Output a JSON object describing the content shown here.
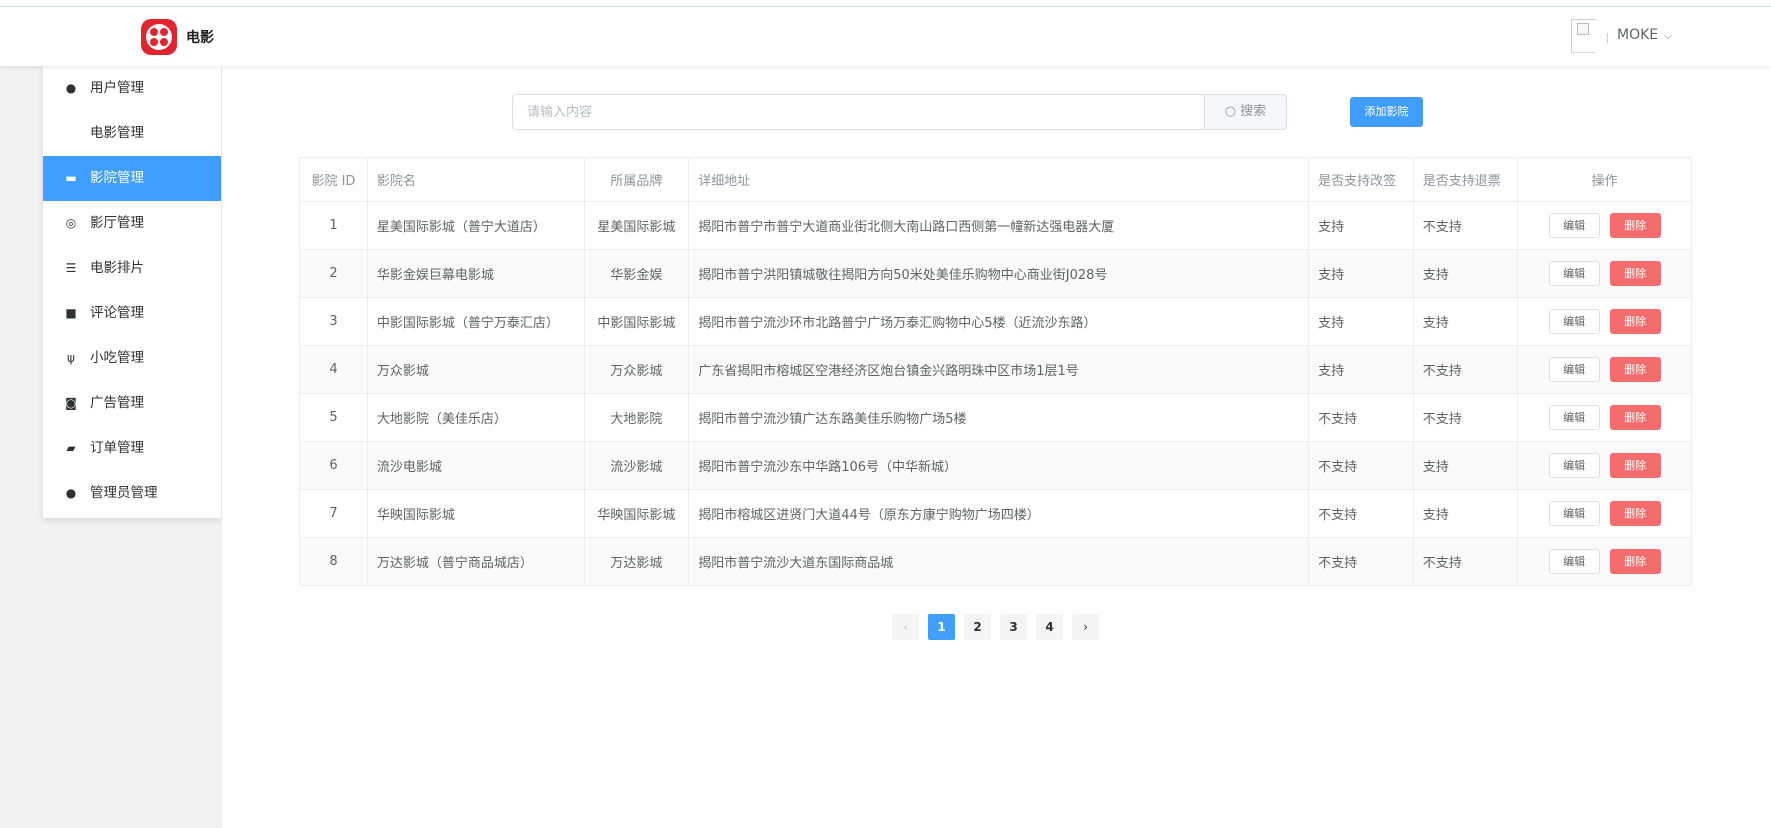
{
  "app": {
    "brand": "电影"
  },
  "user": {
    "name": "MOKE",
    "chevron": "⌵"
  },
  "sidebar": {
    "items": [
      {
        "label": "用户管理",
        "icon": "●"
      },
      {
        "label": "电影管理",
        "icon": ""
      },
      {
        "label": "影院管理",
        "icon": "▬"
      },
      {
        "label": "影厅管理",
        "icon": "◎"
      },
      {
        "label": "电影排片",
        "icon": "☰"
      },
      {
        "label": "评论管理",
        "icon": "■"
      },
      {
        "label": "小吃管理",
        "icon": "ψ"
      },
      {
        "label": "广告管理",
        "icon": "◙"
      },
      {
        "label": "订单管理",
        "icon": "▰"
      },
      {
        "label": "管理员管理",
        "icon": "●"
      }
    ],
    "active_index": 2
  },
  "search": {
    "placeholder": "请输入内容",
    "button_label": "搜索",
    "icon": "○"
  },
  "add_button": "添加影院",
  "table": {
    "headers": [
      "影院 ID",
      "影院名",
      "所属品牌",
      "详细地址",
      "是否支持改签",
      "是否支持退票",
      "操作"
    ],
    "edit_label": "编辑",
    "delete_label": "删除",
    "rows": [
      {
        "id": "1",
        "name": "星美国际影城（普宁大道店）",
        "brand": "星美国际影城",
        "address": "揭阳市普宁市普宁大道商业街北侧大南山路口西侧第一幢新达强电器大厦",
        "change": "支持",
        "refund": "不支持"
      },
      {
        "id": "2",
        "name": "华影金娱巨幕电影城",
        "brand": "华影金娱",
        "address": "揭阳市普宁洪阳镇城敬往揭阳方向50米处美佳乐购物中心商业街J028号",
        "change": "支持",
        "refund": "支持"
      },
      {
        "id": "3",
        "name": "中影国际影城（普宁万泰汇店）",
        "brand": "中影国际影城",
        "address": "揭阳市普宁流沙环市北路普宁广场万泰汇购物中心5楼（近流沙东路）",
        "change": "支持",
        "refund": "支持"
      },
      {
        "id": "4",
        "name": "万众影城",
        "brand": "万众影城",
        "address": "广东省揭阳市榕城区空港经济区炮台镇金兴路明珠中区市场1层1号",
        "change": "支持",
        "refund": "不支持"
      },
      {
        "id": "5",
        "name": "大地影院（美佳乐店）",
        "brand": "大地影院",
        "address": "揭阳市普宁流沙镇广达东路美佳乐购物广场5楼",
        "change": "不支持",
        "refund": "不支持"
      },
      {
        "id": "6",
        "name": "流沙电影城",
        "brand": "流沙影城",
        "address": "揭阳市普宁流沙东中华路106号（中华新城）",
        "change": "不支持",
        "refund": "支持"
      },
      {
        "id": "7",
        "name": "华映国际影城",
        "brand": "华映国际影城",
        "address": "揭阳市榕城区进贤门大道44号（原东方康宁购物广场四楼）",
        "change": "不支持",
        "refund": "支持"
      },
      {
        "id": "8",
        "name": "万达影城（普宁商品城店）",
        "brand": "万达影城",
        "address": "揭阳市普宁流沙大道东国际商品城",
        "change": "不支持",
        "refund": "不支持"
      }
    ]
  },
  "pagination": {
    "prev": "‹",
    "next": "›",
    "pages": [
      "1",
      "2",
      "3",
      "4"
    ],
    "current": "1"
  },
  "colors": {
    "primary": "#409eff",
    "danger": "#f56c6c",
    "logo": "#e0252f"
  }
}
